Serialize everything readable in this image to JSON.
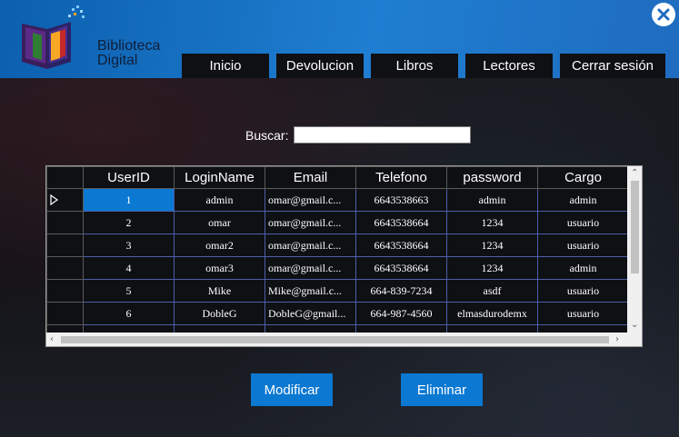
{
  "app": {
    "logo_line1": "Biblioteca",
    "logo_line2": "Digital"
  },
  "nav": {
    "tabs": [
      {
        "label": "Inicio"
      },
      {
        "label": "Devolucion"
      },
      {
        "label": "Libros"
      },
      {
        "label": "Lectores"
      },
      {
        "label": "Cerrar sesión"
      }
    ]
  },
  "search": {
    "label": "Buscar:",
    "value": ""
  },
  "table": {
    "columns": [
      "UserID",
      "LoginName",
      "Email",
      "Telefono",
      "password",
      "Cargo"
    ],
    "rows": [
      {
        "userid": "1",
        "login": "admin",
        "email": "omar@gmail.c...",
        "telefono": "6643538663",
        "password": "admin",
        "cargo": "admin"
      },
      {
        "userid": "2",
        "login": "omar",
        "email": "omar@gmail.c...",
        "telefono": "6643538664",
        "password": "1234",
        "cargo": "usuario"
      },
      {
        "userid": "3",
        "login": "omar2",
        "email": "omar@gmail.c...",
        "telefono": "6643538664",
        "password": "1234",
        "cargo": "usuario"
      },
      {
        "userid": "4",
        "login": "omar3",
        "email": "omar@gmail.c...",
        "telefono": "6643538664",
        "password": "1234",
        "cargo": "admin"
      },
      {
        "userid": "5",
        "login": "Mike",
        "email": "Mike@gmail.c...",
        "telefono": "664-839-7234",
        "password": "asdf",
        "cargo": "usuario"
      },
      {
        "userid": "6",
        "login": "DobleG",
        "email": "DobleG@gmail...",
        "telefono": "664-987-4560",
        "password": "elmasdurodemx",
        "cargo": "usuario"
      }
    ],
    "selected_row": 1
  },
  "actions": {
    "modify_label": "Modificar",
    "delete_label": "Eliminar"
  },
  "colors": {
    "header_blue": "#1f7ed1",
    "accent_blue": "#0b78d1",
    "dark_cell": "#0f1013",
    "grid_line": "#4c5ea8"
  },
  "icons": {
    "close": "close-circle-icon",
    "row_pointer": "row-pointer-triangle-icon",
    "scroll_up": "chevron-up-icon",
    "scroll_down": "chevron-down-icon",
    "scroll_left": "chevron-left-icon",
    "scroll_right": "chevron-right-icon"
  }
}
